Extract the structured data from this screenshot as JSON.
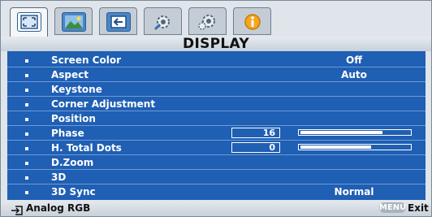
{
  "header": {
    "title": "DISPLAY"
  },
  "tabs": [
    {
      "name": "display-tab-icon",
      "active": true
    },
    {
      "name": "picture-tab-icon",
      "active": false
    },
    {
      "name": "source-tab-icon",
      "active": false
    },
    {
      "name": "system-setup-basic-tab-icon",
      "active": false
    },
    {
      "name": "system-setup-advanced-tab-icon",
      "active": false
    },
    {
      "name": "information-tab-icon",
      "active": false
    }
  ],
  "menu": {
    "items": [
      {
        "label": "Screen Color",
        "value": "Off"
      },
      {
        "label": "Aspect",
        "value": "Auto"
      },
      {
        "label": "Keystone",
        "value": ""
      },
      {
        "label": "Corner Adjustment",
        "value": ""
      },
      {
        "label": "Position",
        "value": ""
      },
      {
        "label": "Phase",
        "number": "16",
        "level": 0.75
      },
      {
        "label": "H. Total Dots",
        "number": "0",
        "level": 0.65
      },
      {
        "label": "D.Zoom",
        "value": ""
      },
      {
        "label": "3D",
        "value": ""
      },
      {
        "label": "3D Sync",
        "value": "Normal"
      }
    ]
  },
  "footer": {
    "source_icon": "input-source-icon",
    "source": "Analog RGB",
    "menu_key": "MENU",
    "exit": "Exit"
  },
  "colors": {
    "panel": "#1f5fb4",
    "row_line": "#6e9ad6",
    "text_light": "#ffffff",
    "icon_blue": "#2d5b8f"
  }
}
